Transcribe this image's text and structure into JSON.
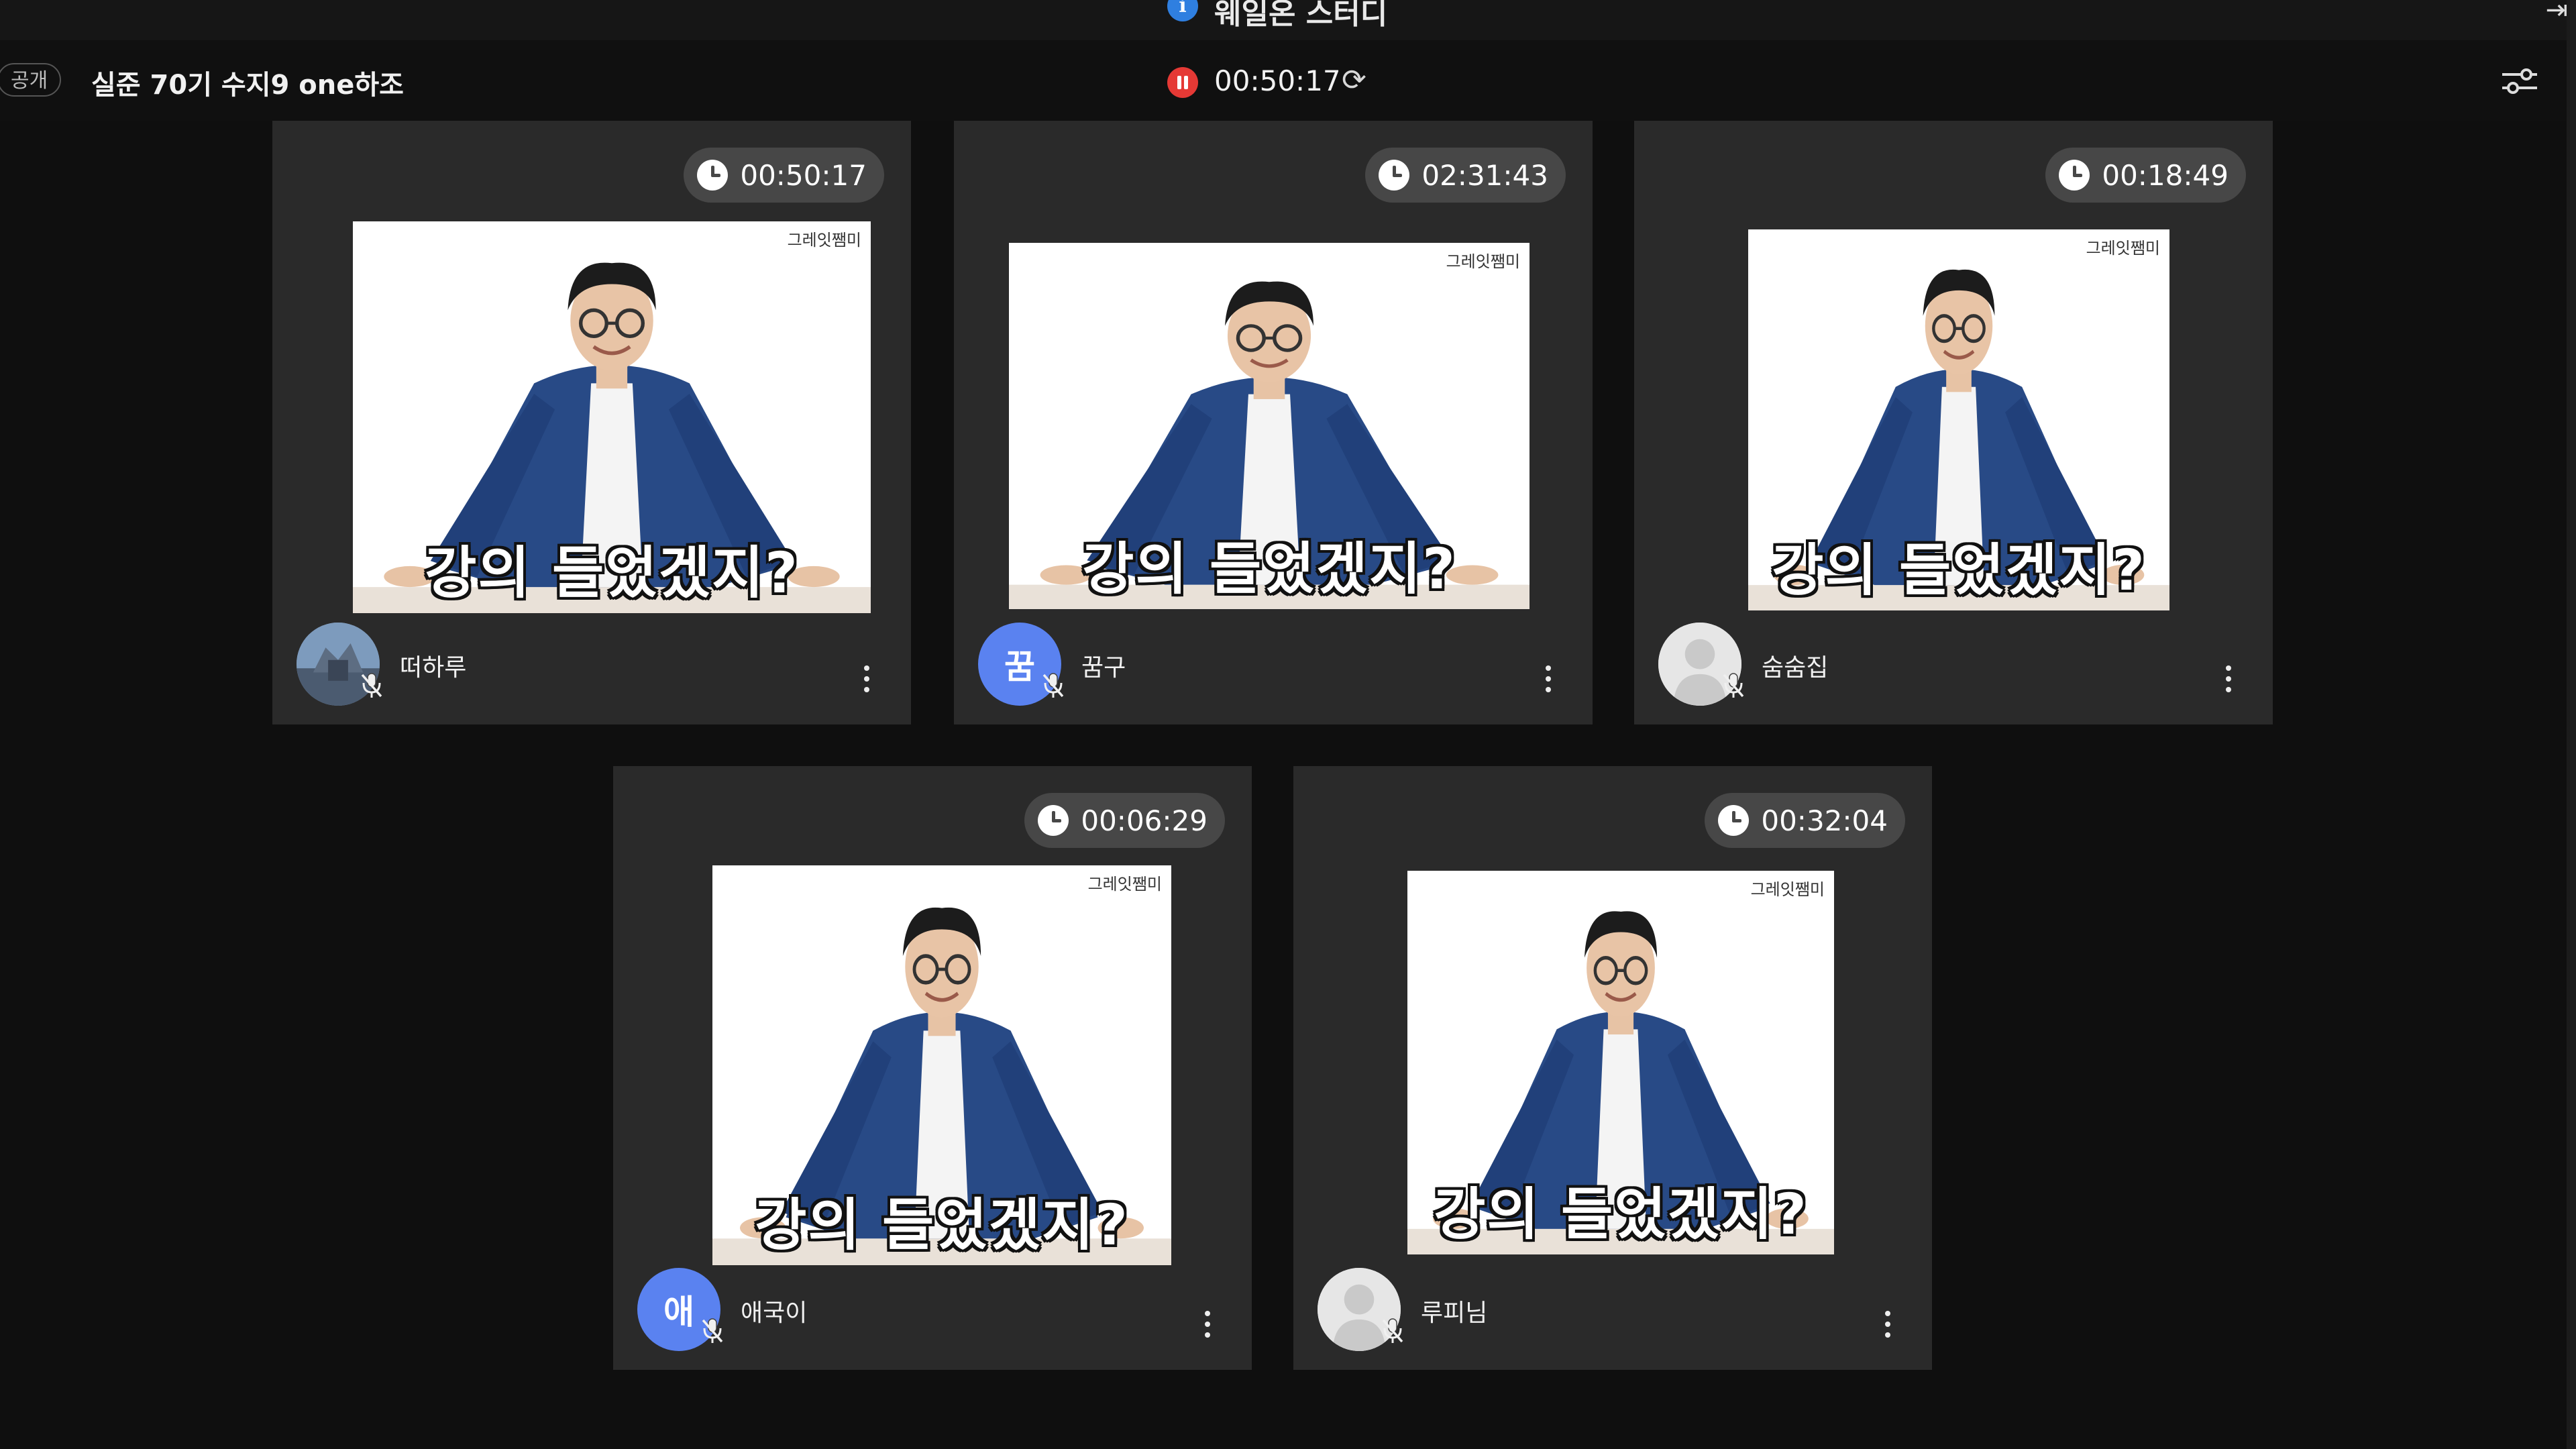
{
  "app": {
    "title": "웨일온 스터디"
  },
  "header": {
    "visibility_badge": "공개",
    "room_title": "실준 70기 수지9 one하조",
    "recording_time": "00:50:17",
    "icons": [
      "record-pause-icon",
      "refresh-icon",
      "settings-sliders-icon"
    ]
  },
  "colors": {
    "background": "#0f0f0f",
    "tile": "#2a2a2a",
    "timer_pill": "#474747",
    "record": "#e53935",
    "avatar_blue": "#5a82f0"
  },
  "tiles": [
    {
      "timer": "00:50:17",
      "watermark": "그레잇쨈미",
      "caption": "강의 들었겠지?",
      "name": "떠하루",
      "avatar_type": "photo",
      "avatar_letter": "",
      "mic": "muted"
    },
    {
      "timer": "02:31:43",
      "watermark": "그레잇쨈미",
      "caption": "강의 들었겠지?",
      "name": "꿈구",
      "avatar_type": "letter",
      "avatar_letter": "꿈",
      "mic": "muted"
    },
    {
      "timer": "00:18:49",
      "watermark": "그레잇쨈미",
      "caption": "강의 들었겠지?",
      "name": "숨숨집",
      "avatar_type": "blank",
      "avatar_letter": "",
      "mic": "muted"
    },
    {
      "timer": "00:06:29",
      "watermark": "그레잇쨈미",
      "caption": "강의 들었겠지?",
      "name": "애국이",
      "avatar_type": "letter",
      "avatar_letter": "애",
      "mic": "muted"
    },
    {
      "timer": "00:32:04",
      "watermark": "그레잇쨈미",
      "caption": "강의 들었겠지?",
      "name": "루피님",
      "avatar_type": "blank",
      "avatar_letter": "",
      "mic": "muted"
    }
  ]
}
